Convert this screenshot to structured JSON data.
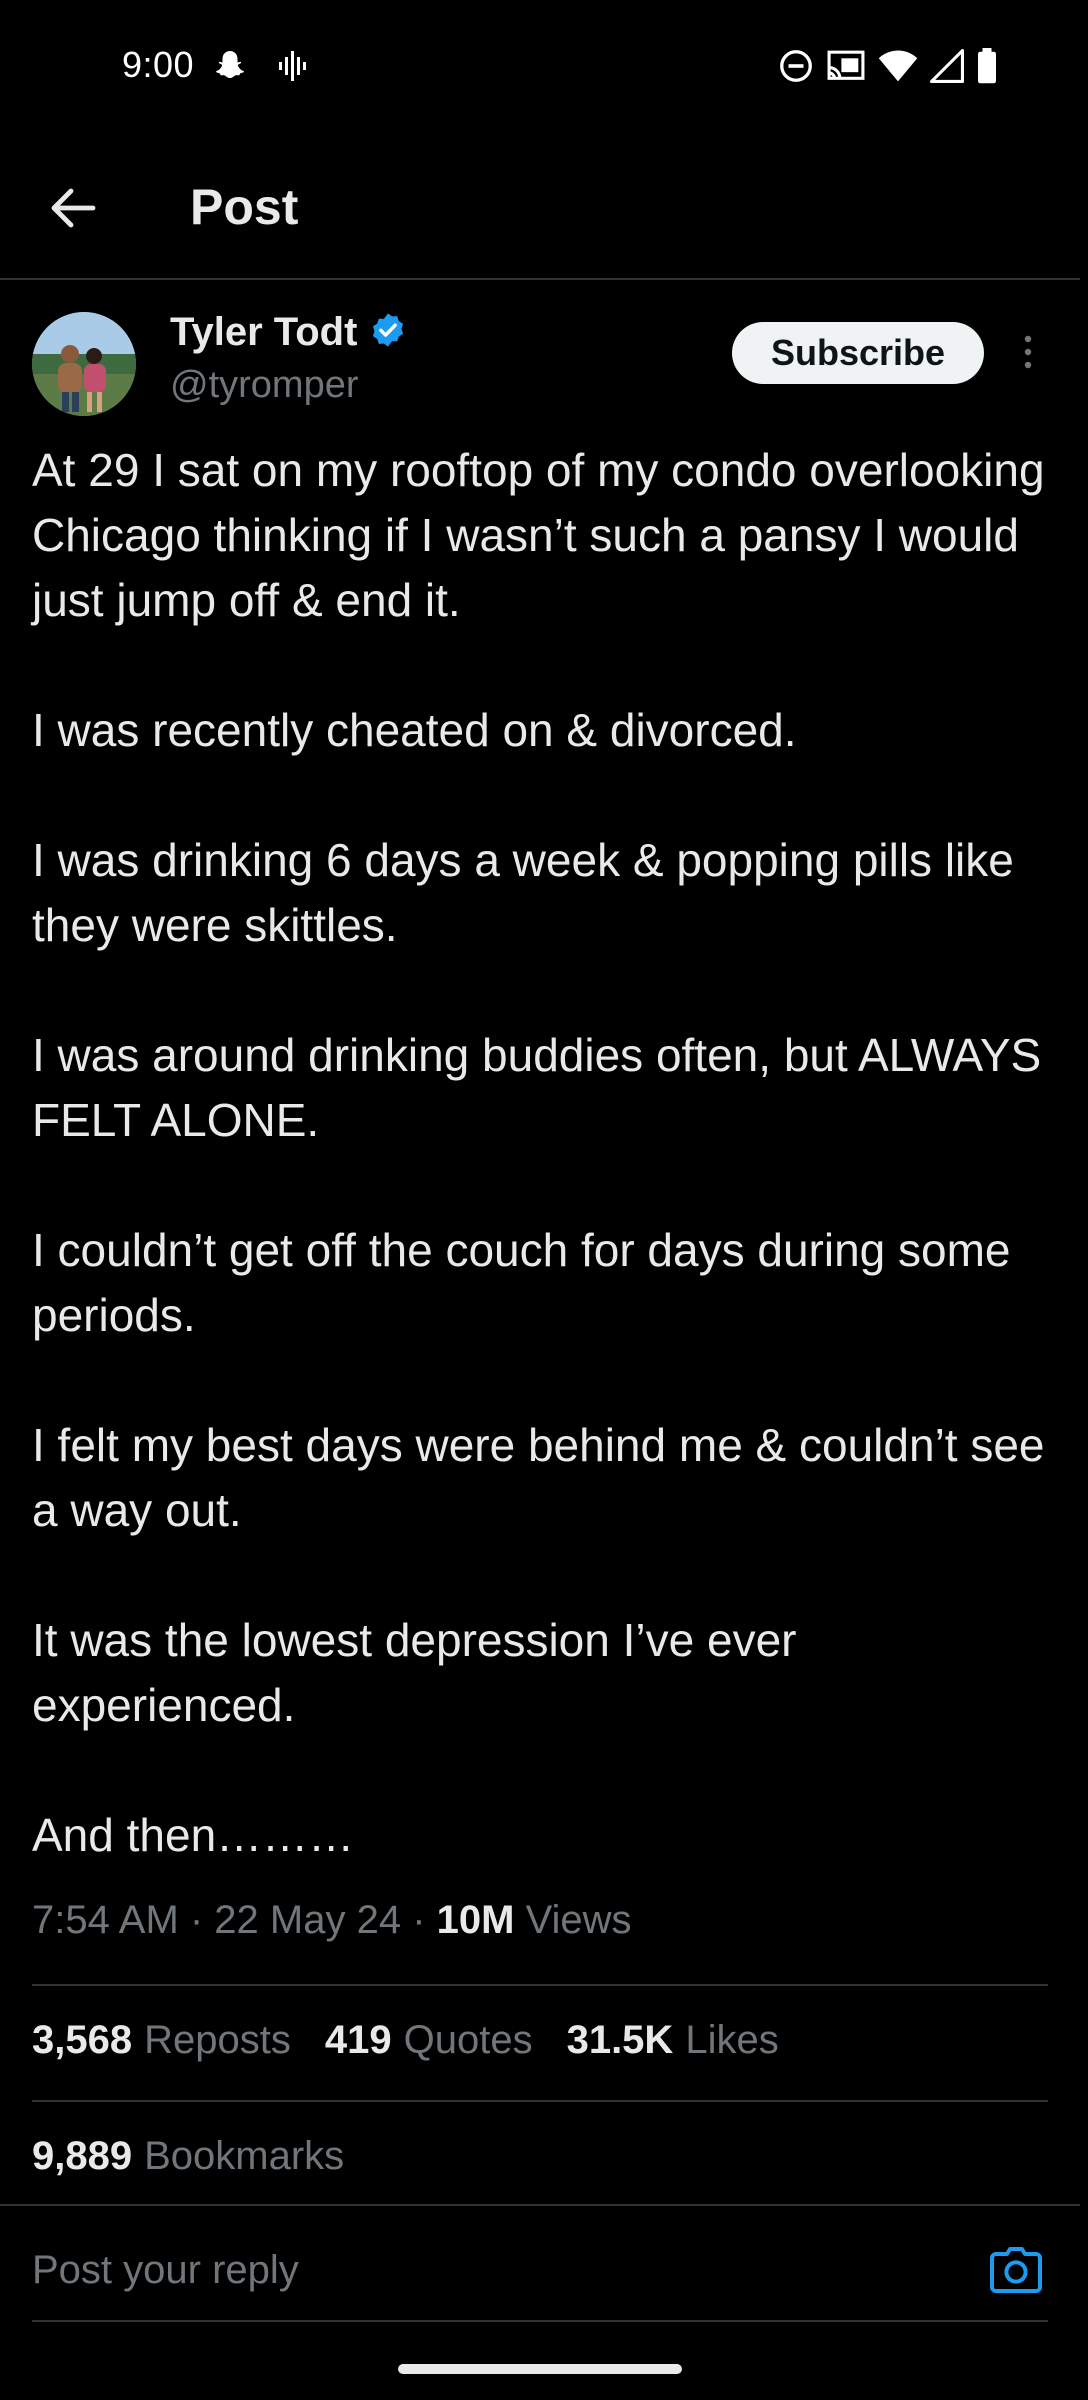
{
  "status_bar": {
    "time": "9:00",
    "icons": [
      "snapchat-icon",
      "audio-wave-icon",
      "do-not-disturb-icon",
      "cast-icon",
      "wifi-icon",
      "cellular-signal-icon",
      "battery-icon"
    ]
  },
  "header": {
    "title": "Post",
    "back_icon": "arrow-left-icon"
  },
  "post": {
    "author": {
      "name": "Tyler Todt",
      "handle": "@tyromper",
      "verified": true
    },
    "subscribe_label": "Subscribe",
    "paragraphs": [
      "At 29 I sat on my rooftop of my condo overlooking Chicago thinking if I wasn’t such a pansy I would just jump off & end it.",
      "I was recently cheated on & divorced.",
      "I was drinking 6 days a week & popping pills like they were skittles.",
      "I was around drinking buddies often, but ALWAYS FELT ALONE.",
      "I couldn’t get off the couch for days  during some periods.",
      "I felt my best days were behind me & couldn’t see a way out.",
      "It was the lowest depression I’ve ever experienced.",
      "And then………"
    ],
    "timestamp": "7:54 AM · 22 May 24 · ",
    "views_count": "10M",
    "views_label": " Views",
    "stats": {
      "reposts_count": "3,568",
      "reposts_label": "Reposts",
      "quotes_count": "419",
      "quotes_label": "Quotes",
      "likes_count": "31.5K",
      "likes_label": "Likes",
      "bookmarks_count": "9,889",
      "bookmarks_label": "Bookmarks"
    }
  },
  "reply": {
    "placeholder": "Post your reply"
  },
  "colors": {
    "background": "#000000",
    "text_primary": "#e7e9ea",
    "text_secondary": "#71767b",
    "accent": "#1d9bf0",
    "divider": "#2f3336"
  }
}
